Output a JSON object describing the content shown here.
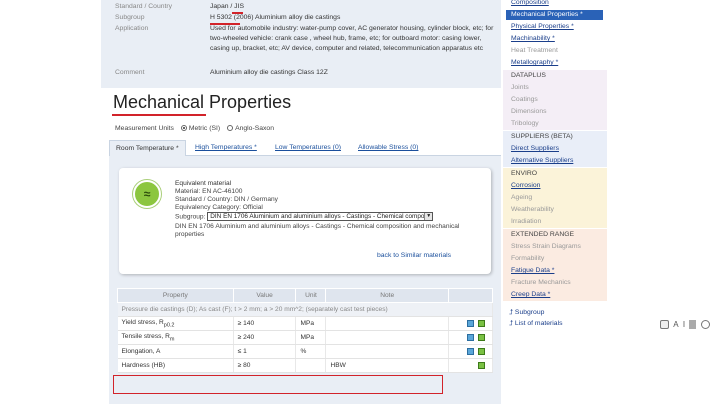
{
  "top_info": {
    "rows": [
      {
        "key": "Standard / Country",
        "value": "Japan / JIS"
      },
      {
        "key": "Subgroup",
        "value": "H 5302 (2006) Aluminium alloy die castings"
      },
      {
        "key": "Application",
        "value": "Used for automobile industry: water-pump cover, AC generator housing, cylinder block, etc; for two-wheeled vehicle: crank case , wheel hub, frame, etc; for outboard motor: casing lower, casing up, bracket, etc; AV device, computer and related, telecommunication apparatus etc"
      },
      {
        "key": "Comment",
        "value": "Aluminium alloy die castings Class 12Z"
      }
    ]
  },
  "page_title": "Mechanical Properties",
  "units": {
    "label": "Measurement Units",
    "metric": "Metric (SI)",
    "anglo": "Anglo-Saxon"
  },
  "tabs": [
    {
      "label": "Room Temperature *"
    },
    {
      "label": "High Temperatures *"
    },
    {
      "label": "Low Temperatures (0)"
    },
    {
      "label": "Allowable Stress (0)"
    }
  ],
  "equivalent": {
    "icon": "equivalent-icon",
    "heading": "Equivalent material",
    "material": "Material: EN AC-46100",
    "standard": "Standard / Country: DIN / Germany",
    "category": "Equivalency Category: Official",
    "subgroup_label": "Subgroup:",
    "subgroup_value": "DIN EN 1706 Aluminium and aluminium alloys - Castings - Chemical composi",
    "description": "DIN EN 1706 Aluminium and aluminium alloys - Castings - Chemical composition and mechanical properties",
    "back_link": "back to Similar materials"
  },
  "table": {
    "headers": [
      "Property",
      "Value",
      "Unit",
      "Note"
    ],
    "group_row": "Pressure die castings (D); As cast (F); t > 2 mm; a > 20 mm^2; (separately cast test pieces)",
    "rows": [
      {
        "property": "Yield stress, R",
        "sub": "p0.2",
        "value": "≥ 140",
        "unit": "MPa",
        "note": "",
        "chart": true
      },
      {
        "property": "Tensile stress, R",
        "sub": "m",
        "value": "≥ 240",
        "unit": "MPa",
        "note": "",
        "chart": true
      },
      {
        "property": "Elongation, A",
        "sub": "",
        "value": "≤ 1",
        "unit": "%",
        "note": "",
        "chart": true
      },
      {
        "property": "Hardness (HB)",
        "sub": "",
        "value": "≥ 80",
        "unit": "",
        "note": "HBW",
        "chart": false
      }
    ]
  },
  "sidebar": {
    "top_item": "Composition",
    "active": "Mechanical Properties *",
    "group1": [
      "Physical Properties *",
      "Machinability *",
      "Heat Treatment",
      "Metallography *"
    ],
    "dataplus_head": "DATAPLUS",
    "dataplus": [
      "Joints",
      "Coatings",
      "Dimensions",
      "Tribology"
    ],
    "suppliers_head": "SUPPLIERS (BETA)",
    "suppliers": [
      "Direct Suppliers",
      "Alternative Suppliers"
    ],
    "enviro_head": "ENVIRO",
    "enviro": [
      "Corrosion",
      "Ageing",
      "Weatherability",
      "Irradiation"
    ],
    "extended_head": "EXTENDED RANGE",
    "extended": [
      "Stress Strain Diagrams",
      "Formability",
      "Fatigue Data *",
      "Fracture Mechanics",
      "Creep Data *"
    ],
    "bottom": [
      "Subgroup",
      "List of materials"
    ]
  },
  "right_controls": {
    "text_size": "A",
    "bold": "I"
  },
  "colors": {
    "accent": "#2a62b7",
    "highlight_red": "#d2232a",
    "dataplus_bg": "#f4eef6",
    "suppliers_bg": "#e9eef8",
    "enviro_bg": "#fbf3d9",
    "extended_bg": "#fbebe1"
  }
}
